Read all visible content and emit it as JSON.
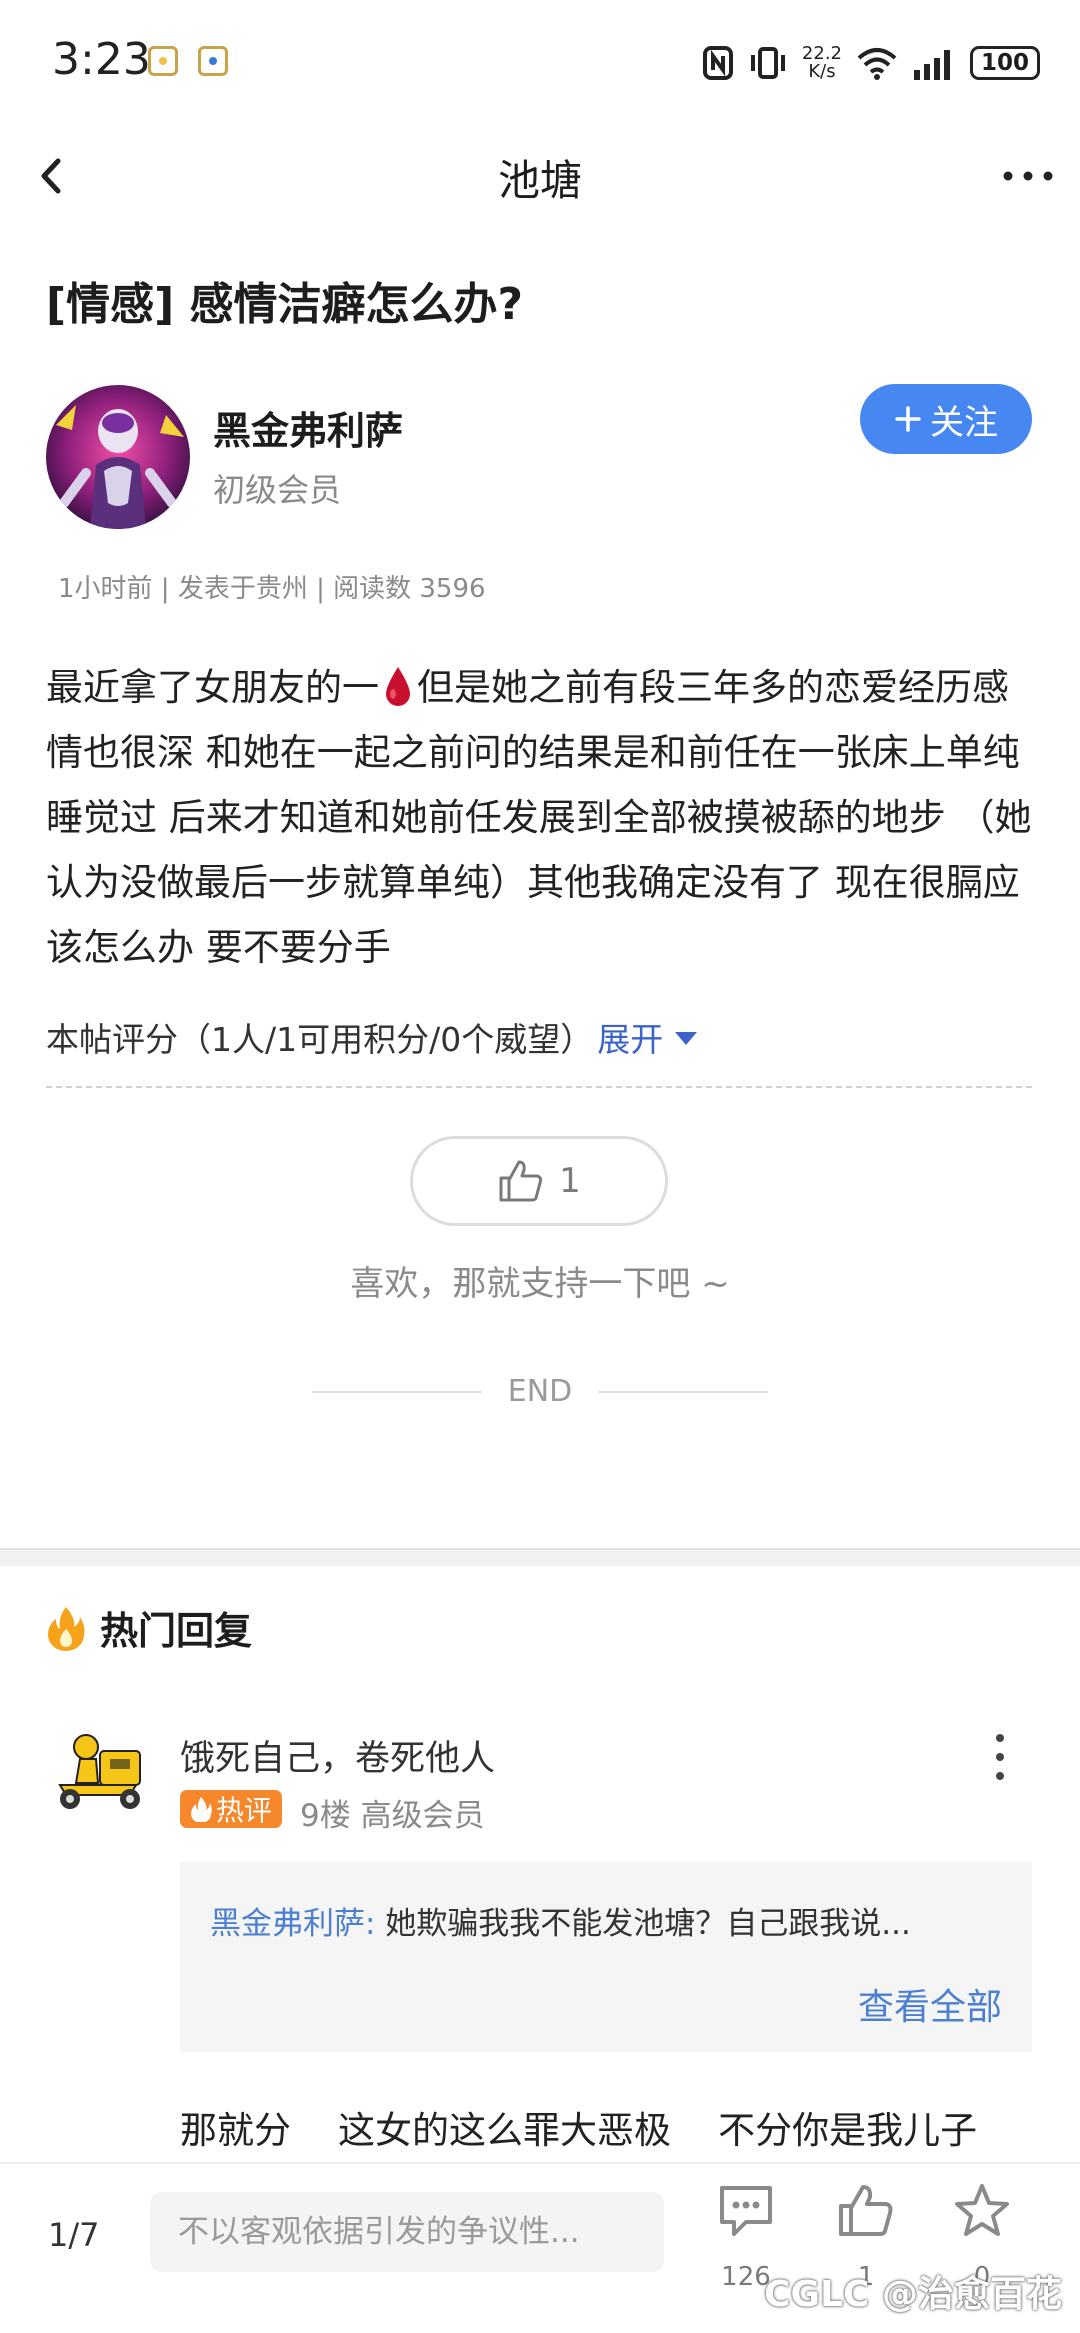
{
  "status_bar": {
    "time": "3:23",
    "net_speed_value": "22.2",
    "net_speed_unit": "K/s",
    "battery": "100",
    "icons": [
      "nfc-icon",
      "vibrate-icon",
      "wifi-icon",
      "signal-icon",
      "battery-icon"
    ]
  },
  "header": {
    "title": "池塘"
  },
  "post": {
    "title": "[情感] 感情洁癖怎么办?",
    "author": {
      "name": "黑金弗利萨",
      "level": "初级会员"
    },
    "follow_label": "关注",
    "meta": "1小时前 | 发表于贵州 | 阅读数 3596",
    "body_part1": "最近拿了女朋友的一",
    "body_part2": "但是她之前有段三年多的恋爱经历感情也很深 和她在一起之前问的结果是和前任在一张床上单纯睡觉过 后来才知道和她前任发展到全部被摸被舔的地步 （她认为没做最后一步就算单纯）其他我确定没有了 现在很膈应 该怎么办 要不要分手",
    "rating_text": "本帖评分（1人/1可用积分/0个威望）",
    "rating_expand": "展开",
    "like_count": "1",
    "like_hint": "喜欢，那就支持一下吧 ~",
    "end_label": "END"
  },
  "hot_replies": {
    "heading": "热门回复",
    "items": [
      {
        "name": "饿死自己，卷死他人",
        "badge": "热评",
        "meta": "9楼 高级会员",
        "quote_author": "黑金弗利萨:",
        "quote_text": " 她欺骗我我不能发池塘？自己跟我说...",
        "view_all": "查看全部",
        "text": "那就分    这女的这么罪大恶极    不分你是我儿子"
      }
    ]
  },
  "bottom_bar": {
    "page": "1/7",
    "input_placeholder": "不以客观依据引发的争议性...",
    "comment_count": "126",
    "like_count": "1",
    "favorite_count": "0"
  },
  "watermark": "CGLC @治愈百花",
  "colors": {
    "accent": "#4787f1",
    "link": "#4a7fd1",
    "hot_badge": "#f6872a"
  }
}
